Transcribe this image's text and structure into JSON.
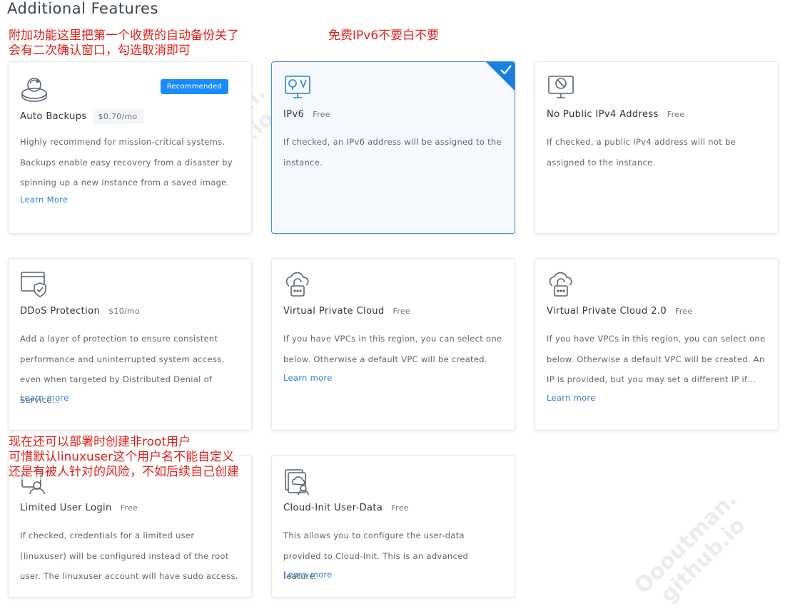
{
  "section": {
    "title": "Additional Features"
  },
  "annotations": {
    "top_left": "附加功能这里把第一个收费的自动备份关了\n会有二次确认窗口，勾选取消即可",
    "top_center": "免费IPv6不要白不要",
    "bottom_left": "现在还可以部署时创建非root用户\n可惜默认linuxuser这个用户名不能自定义\n还是有被人针对的风险，不如后续自己创建"
  },
  "watermark": {
    "line1": "Oooutman.",
    "line2": "github.io"
  },
  "cards": [
    {
      "icon": "backup-icon",
      "name": "Auto Backups",
      "price": "$0.70/mo",
      "badge": "Recommended",
      "selected": false,
      "desc": "Highly recommend for mission-critical systems. Backups enable easy recovery from a disaster by spinning up a new instance from a saved image.",
      "learn": "Learn More"
    },
    {
      "icon": "ipv6-icon",
      "name": "IPv6",
      "price": "Free",
      "selected": true,
      "desc": "If checked, an IPv6 address will be assigned to the instance."
    },
    {
      "icon": "no-public-ipv4-icon",
      "name": "No Public IPv4 Address",
      "price": "Free",
      "selected": false,
      "desc": "If checked, a public IPv4 address will not be assigned to the instance."
    },
    {
      "icon": "ddos-shield-icon",
      "name": "DDoS Protection",
      "price": "$10/mo",
      "selected": false,
      "desc": "Add a layer of protection to ensure consistent performance and uninterrupted system access, even when targeted by Distributed Denial of Service…",
      "learn": "Learn more"
    },
    {
      "icon": "vpc-cloud-lock-icon",
      "name": "Virtual Private Cloud",
      "price": "Free",
      "selected": false,
      "desc": "If you have VPCs in this region, you can select one below. Otherwise a default VPC will be created.",
      "learn": "Learn more"
    },
    {
      "icon": "vpc2-cloud-lock-icon",
      "name": "Virtual Private Cloud 2.0",
      "price": "Free",
      "selected": false,
      "desc": "If you have VPCs in this region, you can select one below. Otherwise a default VPC will be created. An IP is provided, but you may set a different IP if…",
      "learn": "Learn more"
    },
    {
      "icon": "limited-user-icon",
      "name": "Limited User Login",
      "price": "Free",
      "selected": false,
      "desc": "If checked, credentials for a limited user (linuxuser) will be configured instead of the root user. The linuxuser account will have sudo access."
    },
    {
      "icon": "cloud-init-icon",
      "name": "Cloud-Init User-Data",
      "price": "Free",
      "selected": false,
      "desc": "This allows you to configure the user-data provided to Cloud-Init. This is an advanced feature.",
      "learn": "Learn more"
    }
  ],
  "colors": {
    "accent": "#1a8cff",
    "link": "#2d7fd3",
    "selected_border": "#3f8fd6",
    "annotation": "#e0201a"
  }
}
